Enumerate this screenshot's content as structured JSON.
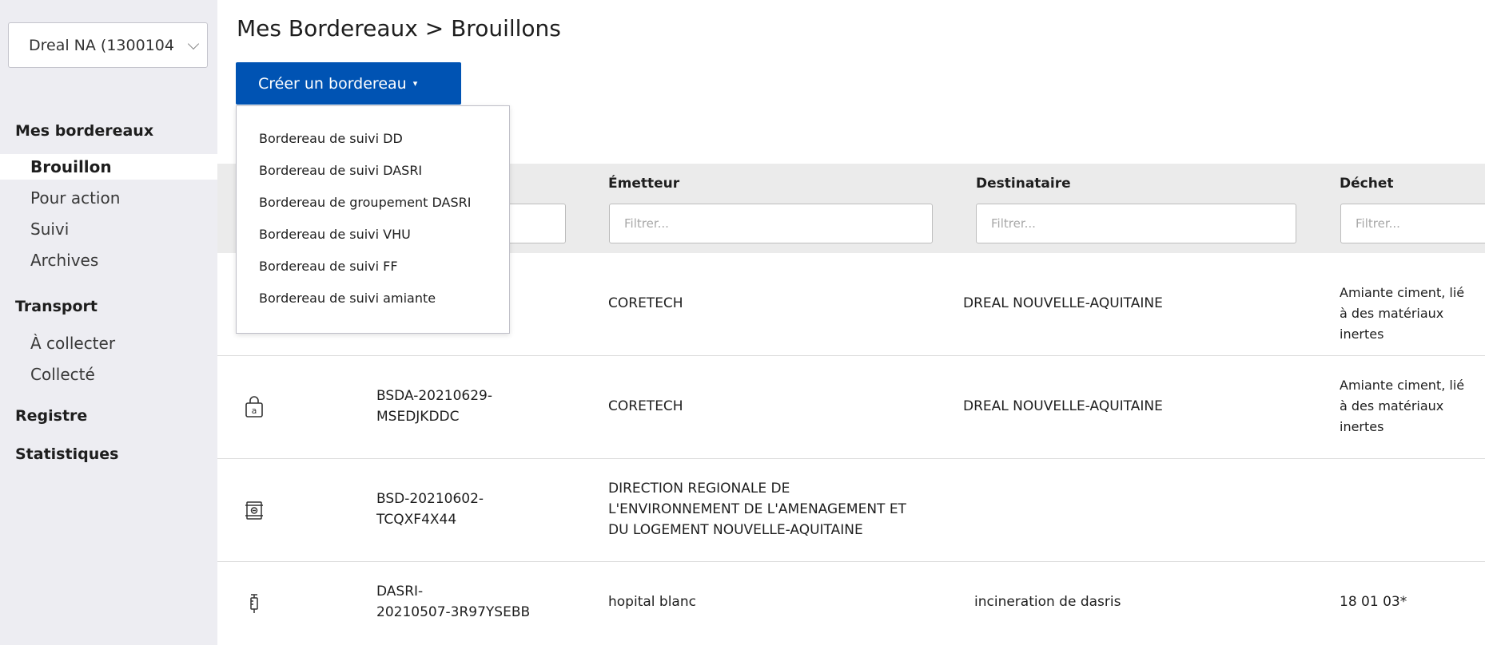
{
  "sidebar": {
    "org_select": "Dreal NA (1300104",
    "sections": {
      "mes_bordereaux": "Mes bordereaux",
      "brouillon": "Brouillon",
      "pour_action": "Pour action",
      "suivi": "Suivi",
      "archives": "Archives",
      "transport": "Transport",
      "a_collecter": "À collecter",
      "collecte": "Collecté",
      "registre": "Registre",
      "statistiques": "Statistiques"
    }
  },
  "header": {
    "title": "Mes Bordereaux > Brouillons",
    "create_button": "Créer un bordereau",
    "create_caret": "▾"
  },
  "dropdown": {
    "items": [
      "Bordereau de suivi DD",
      "Bordereau de suivi DASRI",
      "Bordereau de groupement DASRI",
      "Bordereau de suivi VHU",
      "Bordereau de suivi FF",
      "Bordereau de suivi amiante"
    ]
  },
  "table": {
    "columns": [
      "Émetteur",
      "Destinataire",
      "Déchet"
    ],
    "filter_placeholder": "Filtrer...",
    "rows": [
      {
        "icon": "hidden",
        "id_line1": "",
        "id_line2": "",
        "emitter": [
          "CORETECH"
        ],
        "recipient": "DREAL NOUVELLE-AQUITAINE",
        "waste": [
          "Amiante ciment, lié",
          "à des matériaux",
          "inertes"
        ]
      },
      {
        "icon": "bag-a-icon",
        "id_line1": "BSDA-20210629-",
        "id_line2": "MSEDJKDDC",
        "emitter": [
          "CORETECH"
        ],
        "recipient": "DREAL NOUVELLE-AQUITAINE",
        "waste": [
          "Amiante ciment, lié",
          "à des matériaux",
          "inertes"
        ]
      },
      {
        "icon": "barrel-icon",
        "id_line1": "BSD-20210602-",
        "id_line2": "TCQXF4X44",
        "emitter": [
          "DIRECTION REGIONALE DE",
          "L'ENVIRONNEMENT DE L'AMENAGEMENT ET",
          "DU LOGEMENT NOUVELLE-AQUITAINE"
        ],
        "recipient": "",
        "waste": []
      },
      {
        "icon": "syringe-icon",
        "id_line1": "DASRI-",
        "id_line2": "20210507-3R97YSEBB",
        "emitter": [
          "hopital blanc"
        ],
        "recipient": "incineration de dasris",
        "waste": [
          "18 01 03*"
        ]
      }
    ]
  },
  "colors": {
    "primary": "#0053b3",
    "sidebar_bg": "#ededf2",
    "filter_band": "#ebebeb"
  }
}
